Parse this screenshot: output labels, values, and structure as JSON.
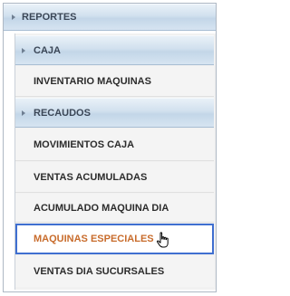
{
  "menu": {
    "root": {
      "label": "REPORTES",
      "icon": "chevron-right-icon"
    },
    "items": [
      {
        "label": "CAJA",
        "type": "submenu-header",
        "icon": "chevron-right-icon"
      },
      {
        "label": "INVENTARIO MAQUINAS",
        "type": "link"
      },
      {
        "label": "RECAUDOS",
        "type": "submenu-header",
        "icon": "chevron-right-icon"
      },
      {
        "label": "MOVIMIENTOS CAJA",
        "type": "link"
      },
      {
        "label": "VENTAS ACUMULADAS",
        "type": "link"
      },
      {
        "label": "ACUMULADO MAQUINA DIA",
        "type": "link"
      },
      {
        "label": "MAQUINAS ESPECIALES",
        "type": "link",
        "state": "hovered"
      },
      {
        "label": "VENTAS DIA SUCURSALES",
        "type": "link"
      }
    ],
    "colors": {
      "header_gradient_top": "#e9f1f8",
      "header_gradient_bottom": "#c3d6e8",
      "selected_text": "#c86c2c",
      "selected_border": "#3f6fd0",
      "leaf_background": "#f4f4f4"
    },
    "cursor": {
      "icon": "hand-pointer-icon"
    }
  }
}
